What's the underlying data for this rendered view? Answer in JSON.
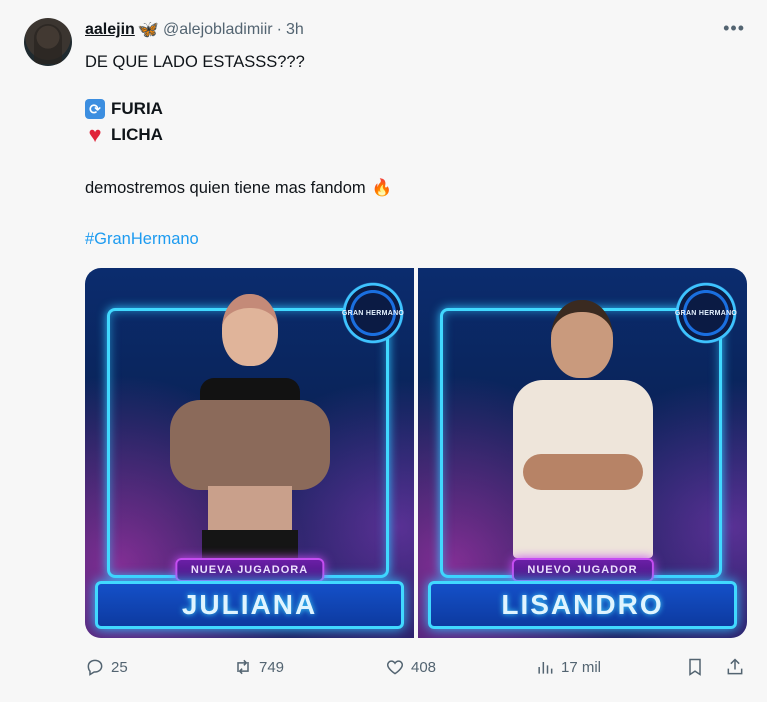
{
  "author": {
    "name": "aalejin",
    "badge_icon": "butterfly-icon",
    "handle": "@alejobladimiir",
    "separator": "·",
    "time": "3h"
  },
  "tweet": {
    "line1": "DE QUE LADO ESTASSS???",
    "option1_label": "FURIA",
    "option1_icon": "repost-emoji-icon",
    "option2_label": "LICHA",
    "option2_icon": "red-heart-emoji-icon",
    "line2": "demostremos quien tiene mas fandom",
    "line2_emoji": "fire-emoji-icon",
    "hashtag": "#GranHermano"
  },
  "media": [
    {
      "logo_text": "GRAN HERMANO",
      "role": "NUEVA JUGADORA",
      "name": "JULIANA"
    },
    {
      "logo_text": "GRAN HERMANO",
      "role": "NUEVO JUGADOR",
      "name": "LISANDRO"
    }
  ],
  "actions": {
    "replies": "25",
    "reposts": "749",
    "likes": "408",
    "views": "17 mil"
  },
  "colors": {
    "link": "#1d9bf0",
    "secondary_text": "#536471",
    "neon_cyan": "#41d9ff",
    "neon_purple": "#c54df2"
  }
}
